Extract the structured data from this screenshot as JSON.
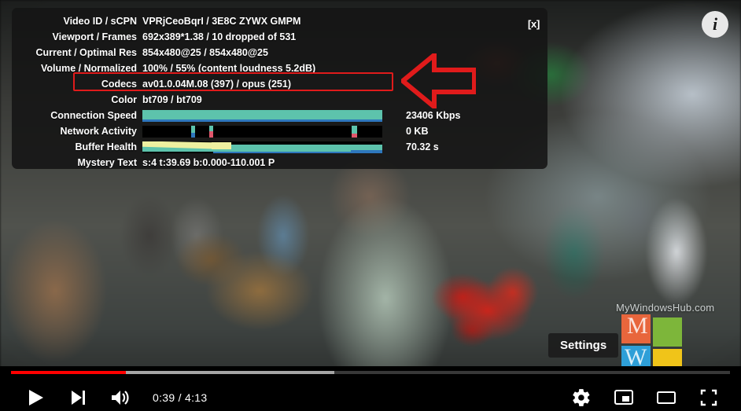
{
  "player": {
    "title": "YouTube video player with Stats for nerds overlay",
    "watermark": "MyWindowsHub.com",
    "logo": {
      "letter_top": "M",
      "letter_bottom": "W"
    }
  },
  "stats": {
    "close_label": "[x]",
    "rows": [
      {
        "label": "Video ID / sCPN",
        "value": "VPRjCeoBqrI / 3E8C ZYWX GMPM"
      },
      {
        "label": "Viewport / Frames",
        "value": "692x389*1.38 / 10 dropped of 531"
      },
      {
        "label": "Current / Optimal Res",
        "value": "854x480@25 / 854x480@25"
      },
      {
        "label": "Volume / Normalized",
        "value": "100% / 55% (content loudness 5.2dB)"
      },
      {
        "label": "Codecs",
        "value": "av01.0.04M.08 (397) / opus (251)"
      },
      {
        "label": "Color",
        "value": "bt709 / bt709"
      }
    ],
    "graphs": [
      {
        "label": "Connection Speed",
        "value": "23406 Kbps"
      },
      {
        "label": "Network Activity",
        "value": "0 KB"
      },
      {
        "label": "Buffer Health",
        "value": "70.32 s"
      }
    ],
    "mystery": {
      "label": "Mystery Text",
      "value": "s:4 t:39.69 b:0.000-110.001 P"
    }
  },
  "annotation": {
    "highlight_target": "Codecs",
    "arrow_direction": "left",
    "color": "#e01b1b"
  },
  "tooltip": {
    "label": "Settings"
  },
  "controls": {
    "play_label": "Play",
    "next_label": "Next",
    "volume_label": "Mute",
    "time": "0:39 / 4:13",
    "current_time": "0:39",
    "duration": "4:13",
    "settings_label": "Settings",
    "miniplayer_label": "Miniplayer",
    "theater_label": "Theater mode",
    "fullscreen_label": "Full screen",
    "progress_percent": 16,
    "buffer_percent": 45,
    "progress_color": "#ff0000"
  },
  "info_button": {
    "glyph": "i"
  }
}
